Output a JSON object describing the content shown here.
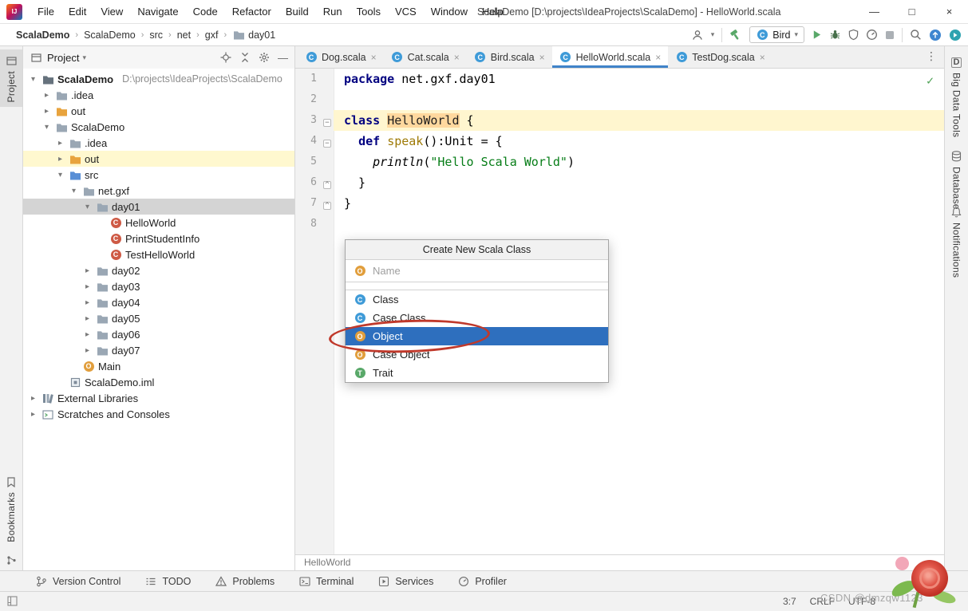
{
  "titlebar": {
    "menus": [
      "File",
      "Edit",
      "View",
      "Navigate",
      "Code",
      "Refactor",
      "Build",
      "Run",
      "Tools",
      "VCS",
      "Window",
      "Help"
    ],
    "title": "ScalaDemo [D:\\projects\\IdeaProjects\\ScalaDemo] - HelloWorld.scala",
    "controls": {
      "minimize": "—",
      "maximize": "□",
      "close": "×"
    }
  },
  "navbar": {
    "breadcrumbs": [
      "ScalaDemo",
      "ScalaDemo",
      "src",
      "net",
      "gxf",
      "day01"
    ],
    "run_config": "Bird",
    "actions": [
      "user",
      "sep",
      "hammer",
      "run-config",
      "run",
      "debug",
      "coverage",
      "profiler",
      "stop",
      "sep",
      "search",
      "update",
      "code-with-me"
    ]
  },
  "left_stripe": {
    "top": [
      {
        "label": "Project",
        "icon": "project-tool",
        "active": true
      }
    ],
    "bottom": [
      {
        "label": "Bookmarks",
        "icon": "bookmark"
      },
      {
        "label": "Structure",
        "icon": "structure"
      }
    ]
  },
  "right_stripe": [
    {
      "label": "Big Data Tools",
      "icon": "bigdata"
    },
    {
      "label": "Database",
      "icon": "database"
    },
    {
      "label": "Notifications",
      "icon": "bell"
    }
  ],
  "project_panel": {
    "title": "Project",
    "tree": [
      {
        "label": "ScalaDemo",
        "suffix": "D:\\projects\\IdeaProjects\\ScalaDemo",
        "indent": 0,
        "chevron": "open",
        "icon": "project",
        "bold": true
      },
      {
        "label": ".idea",
        "indent": 1,
        "chevron": "closed",
        "icon": "folder"
      },
      {
        "label": "out",
        "indent": 1,
        "chevron": "closed",
        "icon": "folder-orange"
      },
      {
        "label": "ScalaDemo",
        "indent": 1,
        "chevron": "open",
        "icon": "folder"
      },
      {
        "label": ".idea",
        "indent": 2,
        "chevron": "closed",
        "icon": "folder"
      },
      {
        "label": "out",
        "indent": 2,
        "chevron": "closed",
        "icon": "folder-orange",
        "state": "highlighted"
      },
      {
        "label": "src",
        "indent": 2,
        "chevron": "open",
        "icon": "folder-src"
      },
      {
        "label": "net.gxf",
        "indent": 3,
        "chevron": "open",
        "icon": "package"
      },
      {
        "label": "day01",
        "indent": 4,
        "chevron": "open",
        "icon": "folder",
        "state": "selected"
      },
      {
        "label": "HelloWorld",
        "indent": 5,
        "chevron": "none",
        "icon": "scala-class"
      },
      {
        "label": "PrintStudentInfo",
        "indent": 5,
        "chevron": "none",
        "icon": "scala-class"
      },
      {
        "label": "TestHelloWorld",
        "indent": 5,
        "chevron": "none",
        "icon": "scala-class"
      },
      {
        "label": "day02",
        "indent": 4,
        "chevron": "closed",
        "icon": "folder"
      },
      {
        "label": "day03",
        "indent": 4,
        "chevron": "closed",
        "icon": "folder"
      },
      {
        "label": "day04",
        "indent": 4,
        "chevron": "closed",
        "icon": "folder"
      },
      {
        "label": "day05",
        "indent": 4,
        "chevron": "closed",
        "icon": "folder"
      },
      {
        "label": "day06",
        "indent": 4,
        "chevron": "closed",
        "icon": "folder"
      },
      {
        "label": "day07",
        "indent": 4,
        "chevron": "closed",
        "icon": "folder"
      },
      {
        "label": "Main",
        "indent": 3,
        "chevron": "none",
        "icon": "scala-object"
      },
      {
        "label": "ScalaDemo.iml",
        "indent": 2,
        "chevron": "none",
        "icon": "module"
      },
      {
        "label": "External Libraries",
        "indent": 0,
        "chevron": "closed",
        "icon": "libraries"
      },
      {
        "label": "Scratches and Consoles",
        "indent": 0,
        "chevron": "closed",
        "icon": "scratches"
      }
    ]
  },
  "editor": {
    "tabs": [
      {
        "label": "Dog.scala"
      },
      {
        "label": "Cat.scala"
      },
      {
        "label": "Bird.scala"
      },
      {
        "label": "HelloWorld.scala",
        "active": true
      },
      {
        "label": "TestDog.scala"
      }
    ],
    "lines": [
      {
        "num": 1,
        "fold": "",
        "segments": [
          {
            "t": "package",
            "c": "k"
          },
          {
            "t": " net.gxf.day01",
            "c": "p"
          }
        ]
      },
      {
        "num": 2,
        "fold": "",
        "segments": []
      },
      {
        "num": 3,
        "fold": "open",
        "caret": true,
        "segments": [
          {
            "t": "class",
            "c": "k"
          },
          {
            "t": " ",
            "c": "p"
          },
          {
            "t": "HelloWorld",
            "c": "h"
          },
          {
            "t": " {",
            "c": "p"
          }
        ]
      },
      {
        "num": 4,
        "fold": "open",
        "segments": [
          {
            "t": "  ",
            "c": "p"
          },
          {
            "t": "def",
            "c": "k"
          },
          {
            "t": " ",
            "c": "p"
          },
          {
            "t": "speak",
            "c": "f"
          },
          {
            "t": "():Unit = {",
            "c": "p"
          }
        ]
      },
      {
        "num": 5,
        "fold": "",
        "segments": [
          {
            "t": "    ",
            "c": "p"
          },
          {
            "t": "println",
            "c": "i"
          },
          {
            "t": "(",
            "c": "p"
          },
          {
            "t": "\"Hello Scala World\"",
            "c": "s"
          },
          {
            "t": ")",
            "c": "p"
          }
        ]
      },
      {
        "num": 6,
        "fold": "end",
        "segments": [
          {
            "t": "  }",
            "c": "p"
          }
        ]
      },
      {
        "num": 7,
        "fold": "end",
        "segments": [
          {
            "t": "}",
            "c": "p"
          }
        ]
      },
      {
        "num": 8,
        "fold": "",
        "segments": []
      }
    ],
    "breadcrumb": "HelloWorld"
  },
  "dialog": {
    "title": "Create New Scala Class",
    "name_placeholder": "Name",
    "kinds": [
      {
        "label": "Class",
        "icon": "class"
      },
      {
        "label": "Case Class",
        "icon": "class"
      },
      {
        "label": "Object",
        "icon": "object",
        "selected": true
      },
      {
        "label": "Case Object",
        "icon": "object"
      },
      {
        "label": "Trait",
        "icon": "trait"
      }
    ]
  },
  "bottom_bar": [
    {
      "label": "Version Control",
      "icon": "vc"
    },
    {
      "label": "TODO",
      "icon": "todo"
    },
    {
      "label": "Problems",
      "icon": "problems"
    },
    {
      "label": "Terminal",
      "icon": "terminal"
    },
    {
      "label": "Services",
      "icon": "services"
    },
    {
      "label": "Profiler",
      "icon": "profiler-small"
    }
  ],
  "status_bar": {
    "caret_position": "3:7",
    "line_separator": "CRLF",
    "encoding": "UTF-8"
  },
  "watermark": {
    "text": "CSDN @dmzqw1123"
  }
}
